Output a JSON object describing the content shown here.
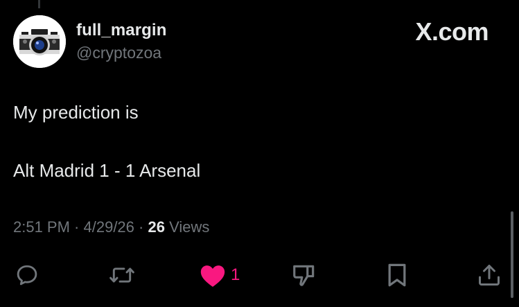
{
  "author": {
    "display_name": "full_margin",
    "handle": "@cryptozoa",
    "avatar_icon": "camera-icon"
  },
  "brand": {
    "label": "X.com"
  },
  "tweet": {
    "lines": [
      "My prediction is",
      "Alt Madrid 1 - 1 Arsenal"
    ]
  },
  "meta": {
    "time": "2:51 PM",
    "separator1": " · ",
    "date": "4/29/26",
    "separator2": " · ",
    "views_count": "26",
    "views_label": " Views"
  },
  "actions": {
    "reply_icon": "reply-icon",
    "retweet_icon": "retweet-icon",
    "like_icon": "heart-icon",
    "like_count": "1",
    "dislike_icon": "thumbs-down-icon",
    "bookmark_icon": "bookmark-icon",
    "share_icon": "share-icon"
  },
  "colors": {
    "background": "#000000",
    "text_primary": "#e7e9ea",
    "text_secondary": "#71767b",
    "like_pink": "#f91880",
    "icon_gray": "#71767b"
  }
}
